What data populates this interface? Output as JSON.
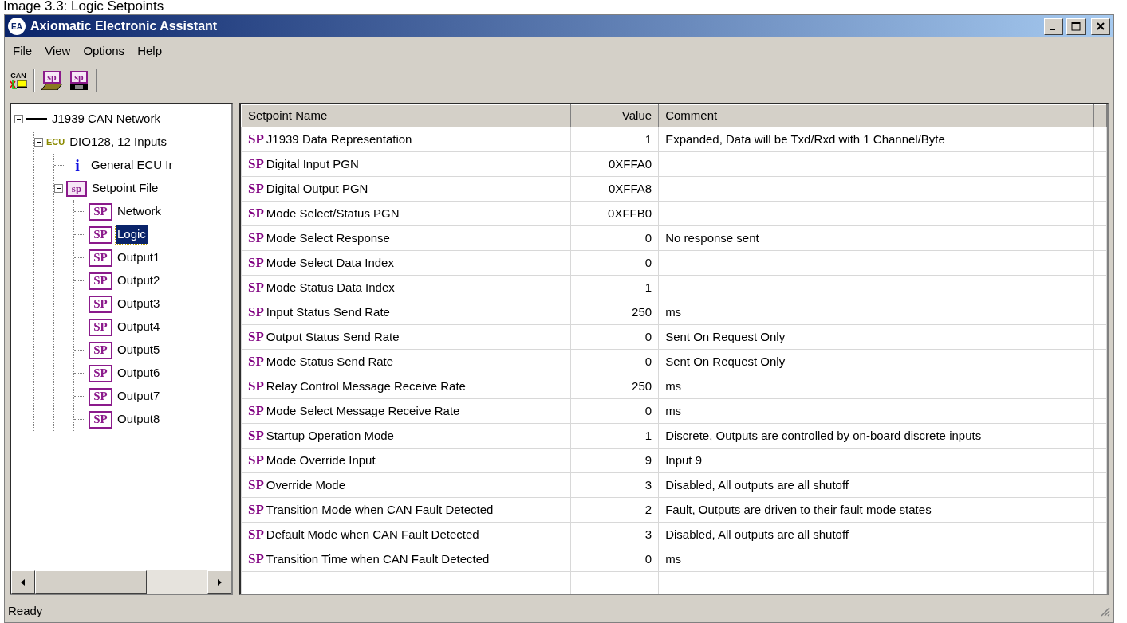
{
  "caption": "Image 3.3: Logic Setpoints",
  "window": {
    "title": "Axiomatic Electronic Assistant",
    "logo_text": "EA"
  },
  "menu": [
    "File",
    "View",
    "Options",
    "Help"
  ],
  "toolbar": [
    {
      "kind": "can",
      "text": "CAN"
    },
    {
      "kind": "sp-open",
      "text": "sp"
    },
    {
      "kind": "sp-save",
      "text": "sp"
    }
  ],
  "tree": [
    {
      "label": "J1939 CAN Network",
      "kind": "line",
      "expanded": true,
      "selected": false,
      "children": [
        {
          "label": "DIO128, 12 Inputs",
          "kind": "ecu",
          "icon_text": "ECU",
          "expanded": true,
          "selected": false,
          "children": [
            {
              "label": "General ECU Ir",
              "kind": "info",
              "icon_text": "i",
              "selected": false
            },
            {
              "label": "Setpoint File",
              "kind": "spfile",
              "icon_text": "sp",
              "expanded": true,
              "selected": false,
              "children": [
                {
                  "label": "Network",
                  "kind": "sp",
                  "icon_text": "SP",
                  "selected": false
                },
                {
                  "label": "Logic",
                  "kind": "sp",
                  "icon_text": "SP",
                  "selected": true
                },
                {
                  "label": "Output1",
                  "kind": "sp",
                  "icon_text": "SP",
                  "selected": false
                },
                {
                  "label": "Output2",
                  "kind": "sp",
                  "icon_text": "SP",
                  "selected": false
                },
                {
                  "label": "Output3",
                  "kind": "sp",
                  "icon_text": "SP",
                  "selected": false
                },
                {
                  "label": "Output4",
                  "kind": "sp",
                  "icon_text": "SP",
                  "selected": false
                },
                {
                  "label": "Output5",
                  "kind": "sp",
                  "icon_text": "SP",
                  "selected": false
                },
                {
                  "label": "Output6",
                  "kind": "sp",
                  "icon_text": "SP",
                  "selected": false
                },
                {
                  "label": "Output7",
                  "kind": "sp",
                  "icon_text": "SP",
                  "selected": false
                },
                {
                  "label": "Output8",
                  "kind": "sp",
                  "icon_text": "SP",
                  "selected": false
                }
              ]
            }
          ]
        }
      ]
    }
  ],
  "table": {
    "columns": [
      "Setpoint Name",
      "Value",
      "Comment"
    ],
    "rows": [
      {
        "icon_text": "SP",
        "name": "J1939 Data Representation",
        "value": "1",
        "comment": "Expanded, Data will be Txd/Rxd with 1 Channel/Byte"
      },
      {
        "icon_text": "SP",
        "name": "Digital Input PGN",
        "value": "0XFFA0",
        "comment": ""
      },
      {
        "icon_text": "SP",
        "name": "Digital Output PGN",
        "value": "0XFFA8",
        "comment": ""
      },
      {
        "icon_text": "SP",
        "name": "Mode Select/Status PGN",
        "value": "0XFFB0",
        "comment": ""
      },
      {
        "icon_text": "SP",
        "name": "Mode Select Response",
        "value": "0",
        "comment": "No response sent"
      },
      {
        "icon_text": "SP",
        "name": "Mode Select Data Index",
        "value": "0",
        "comment": ""
      },
      {
        "icon_text": "SP",
        "name": "Mode Status Data Index",
        "value": "1",
        "comment": ""
      },
      {
        "icon_text": "SP",
        "name": "Input Status Send Rate",
        "value": "250",
        "comment": "ms"
      },
      {
        "icon_text": "SP",
        "name": "Output Status Send Rate",
        "value": "0",
        "comment": "Sent On Request Only"
      },
      {
        "icon_text": "SP",
        "name": "Mode Status Send Rate",
        "value": "0",
        "comment": "Sent On Request Only"
      },
      {
        "icon_text": "SP",
        "name": "Relay Control Message Receive Rate",
        "value": "250",
        "comment": "ms"
      },
      {
        "icon_text": "SP",
        "name": "Mode Select Message Receive Rate",
        "value": "0",
        "comment": "ms"
      },
      {
        "icon_text": "SP",
        "name": "Startup Operation Mode",
        "value": "1",
        "comment": "Discrete, Outputs are controlled by on-board discrete inputs"
      },
      {
        "icon_text": "SP",
        "name": "Mode Override Input",
        "value": "9",
        "comment": "Input 9"
      },
      {
        "icon_text": "SP",
        "name": "Override Mode",
        "value": "3",
        "comment": "Disabled, All outputs are all shutoff"
      },
      {
        "icon_text": "SP",
        "name": "Transition Mode when CAN Fault Detected",
        "value": "2",
        "comment": "Fault, Outputs are driven to their fault mode states"
      },
      {
        "icon_text": "SP",
        "name": "Default Mode when CAN Fault Detected",
        "value": "3",
        "comment": "Disabled, All outputs are all shutoff"
      },
      {
        "icon_text": "SP",
        "name": "Transition Time when CAN Fault Detected",
        "value": "0",
        "comment": "ms"
      }
    ]
  },
  "status_bar": "Ready"
}
